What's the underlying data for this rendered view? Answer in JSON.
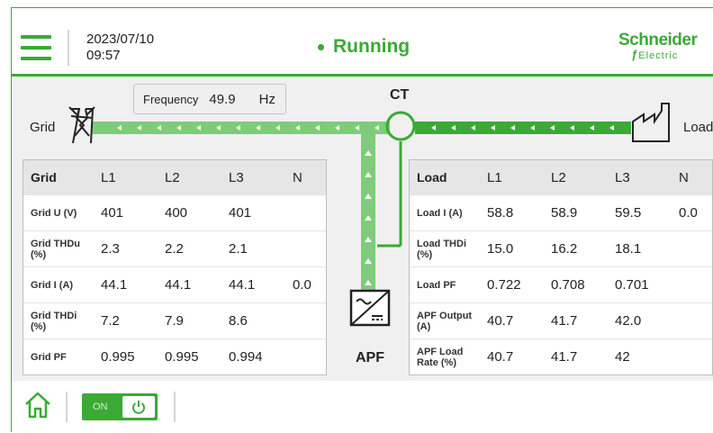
{
  "header": {
    "date": "2023/07/10",
    "time": "09:57",
    "status": "Running",
    "brand_line1": "Schneider",
    "brand_line2": "Electric"
  },
  "diagram": {
    "frequency_label": "Frequency",
    "frequency_value": "49.9",
    "frequency_unit": "Hz",
    "grid_label": "Grid",
    "ct_label": "CT",
    "load_label": "Load",
    "apf_label": "APF"
  },
  "grid_table": {
    "header": "Grid",
    "columns": [
      "L1",
      "L2",
      "L3",
      "N"
    ],
    "rows": [
      {
        "label": "Grid U (V)",
        "values": [
          "401",
          "400",
          "401",
          ""
        ]
      },
      {
        "label": "Grid THDu (%)",
        "values": [
          "2.3",
          "2.2",
          "2.1",
          ""
        ]
      },
      {
        "label": "Grid I (A)",
        "values": [
          "44.1",
          "44.1",
          "44.1",
          "0.0"
        ]
      },
      {
        "label": "Grid THDi (%)",
        "values": [
          "7.2",
          "7.9",
          "8.6",
          ""
        ]
      },
      {
        "label": "Grid PF",
        "values": [
          "0.995",
          "0.995",
          "0.994",
          ""
        ]
      }
    ]
  },
  "load_table": {
    "header": "Load",
    "columns": [
      "L1",
      "L2",
      "L3",
      "N"
    ],
    "rows": [
      {
        "label": "Load I (A)",
        "values": [
          "58.8",
          "58.9",
          "59.5",
          "0.0"
        ]
      },
      {
        "label": "Load THDi (%)",
        "values": [
          "15.0",
          "16.2",
          "18.1",
          ""
        ]
      },
      {
        "label": "Load PF",
        "values": [
          "0.722",
          "0.708",
          "0.701",
          ""
        ]
      },
      {
        "label": "APF Output (A)",
        "values": [
          "40.7",
          "41.7",
          "42.0",
          ""
        ]
      },
      {
        "label": "APF Load Rate (%)",
        "values": [
          "40.7",
          "41.7",
          "42",
          ""
        ]
      }
    ]
  },
  "footer": {
    "power_state": "ON"
  },
  "colors": {
    "accent": "#3aaa35",
    "flow_light": "#7fcb7b"
  },
  "icons": [
    "menu-icon",
    "grid-tower-icon",
    "ct-sensor-icon",
    "factory-icon",
    "apf-device-icon",
    "home-icon",
    "power-icon"
  ]
}
